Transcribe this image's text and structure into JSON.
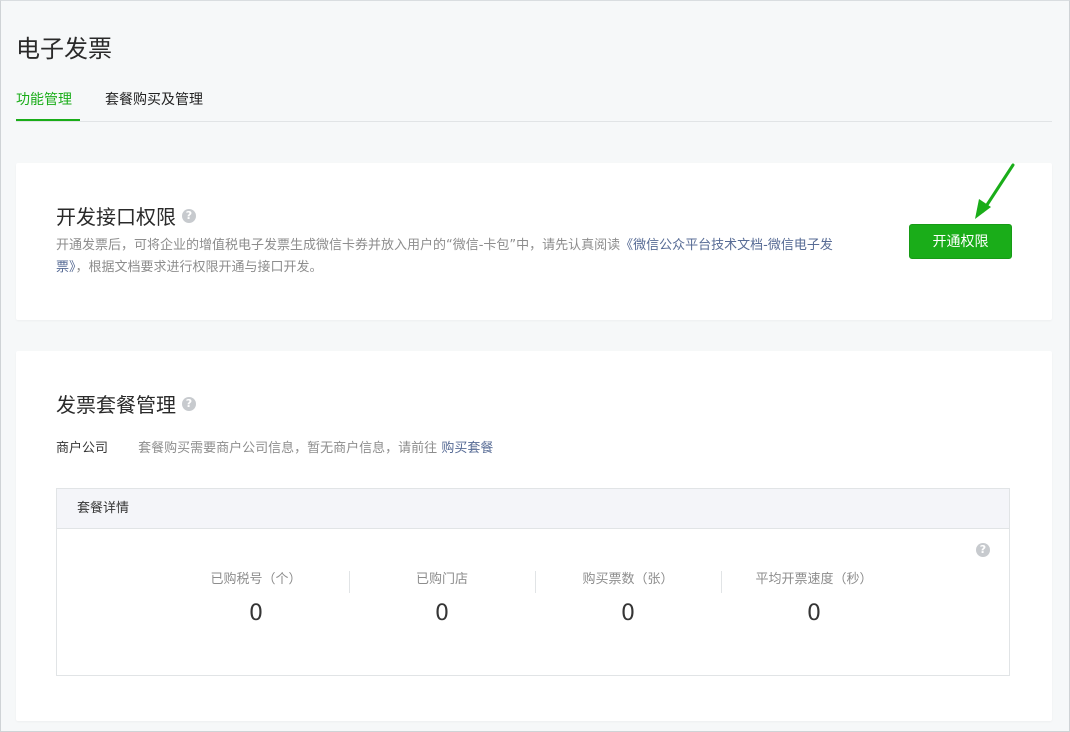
{
  "page": {
    "title": "电子发票"
  },
  "tabs": [
    {
      "label": "功能管理",
      "active": true
    },
    {
      "label": "套餐购买及管理",
      "active": false
    }
  ],
  "api_permission": {
    "title": "开发接口权限",
    "desc_prefix": "开通发票后，可将企业的增值税电子发票生成微信卡券并放入用户的“微信-卡包”中，请先认真阅读",
    "doc_link": "《微信公众平台技术文档-微信电子发票》",
    "desc_suffix": "，根据文档要求进行权限开通与接口开发。",
    "button_label": "开通权限"
  },
  "package_mgmt": {
    "title": "发票套餐管理",
    "merchant_label": "商户公司",
    "merchant_info": "套餐购买需要商户公司信息，暂无商户信息，请前往",
    "buy_link": "购买套餐",
    "detail_header": "套餐详情",
    "stats": [
      {
        "label": "已购税号（个）",
        "value": "0"
      },
      {
        "label": "已购门店",
        "value": "0"
      },
      {
        "label": "购买票数（张）",
        "value": "0"
      },
      {
        "label": "平均开票速度（秒）",
        "value": "0"
      }
    ]
  },
  "colors": {
    "accent": "#1aad19",
    "link": "#576b95"
  },
  "icons": {
    "help": "help-icon",
    "annotation": "arrow-annotation-icon"
  }
}
